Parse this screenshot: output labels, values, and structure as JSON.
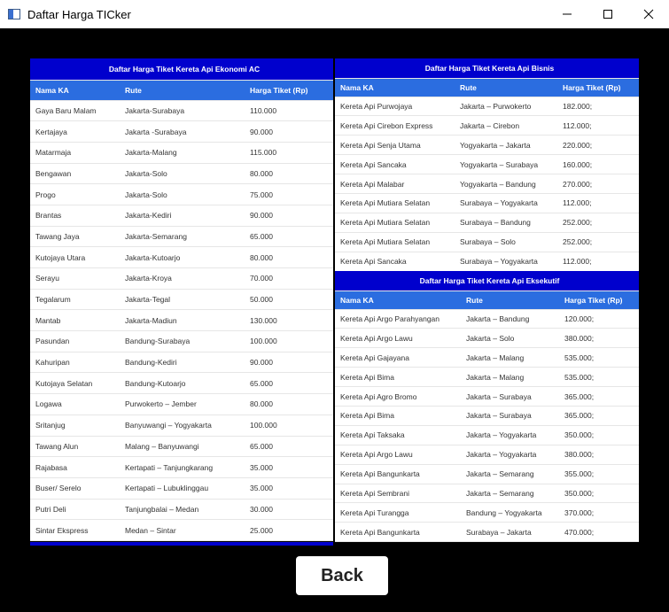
{
  "window": {
    "title": "Daftar Harga TICker"
  },
  "ekonomi": {
    "title": "Daftar Harga Tiket Kereta Api Ekonomi AC",
    "headers": [
      "Nama KA",
      "Rute",
      "Harga Tiket (Rp)"
    ],
    "rows": [
      [
        "Gaya Baru Malam",
        "Jakarta-Surabaya",
        "110.000"
      ],
      [
        "Kertajaya",
        "Jakarta -Surabaya",
        "90.000"
      ],
      [
        "Matarmaja",
        "Jakarta-Malang",
        "115.000"
      ],
      [
        "Bengawan",
        "Jakarta-Solo",
        "80.000"
      ],
      [
        "Progo",
        "Jakarta-Solo",
        "75.000"
      ],
      [
        "Brantas",
        "Jakarta-Kediri",
        "90.000"
      ],
      [
        "Tawang Jaya",
        "Jakarta-Semarang",
        "65.000"
      ],
      [
        "Kutojaya Utara",
        "Jakarta-Kutoarjo",
        "80.000"
      ],
      [
        "Serayu",
        "Jakarta-Kroya",
        "70.000"
      ],
      [
        "Tegalarum",
        "Jakarta-Tegal",
        "50.000"
      ],
      [
        "Mantab",
        "Jakarta-Madiun",
        "130.000"
      ],
      [
        "Pasundan",
        "Bandung-Surabaya",
        "100.000"
      ],
      [
        "Kahuripan",
        "Bandung-Kediri",
        "90.000"
      ],
      [
        "Kutojaya Selatan",
        "Bandung-Kutoarjo",
        "65.000"
      ],
      [
        "Logawa",
        "Purwokerto – Jember",
        "80.000"
      ],
      [
        "Sritanjug",
        "Banyuwangi – Yogyakarta",
        "100.000"
      ],
      [
        "Tawang Alun",
        "Malang – Banyuwangi",
        "65.000"
      ],
      [
        "Rajabasa",
        "Kertapati – Tanjungkarang",
        "35.000"
      ],
      [
        "Buser/ Serelo",
        "Kertapati – Lubuklinggau",
        "35.000"
      ],
      [
        "Putri Deli",
        "Tanjungbalai – Medan",
        "30.000"
      ],
      [
        "Sintar Ekspress",
        "Medan – Sintar",
        "25.000"
      ]
    ]
  },
  "bisnis": {
    "title": "Daftar Harga Tiket Kereta Api Bisnis",
    "headers": [
      "Nama KA",
      "Rute",
      "Harga Tiket (Rp)"
    ],
    "rows": [
      [
        "Kereta Api Purwojaya",
        "Jakarta – Purwokerto",
        "182.000;"
      ],
      [
        "Kereta Api Cirebon Express",
        "Jakarta – Cirebon",
        "112.000;"
      ],
      [
        "Kereta Api Senja Utama",
        "Yogyakarta – Jakarta",
        "220.000;"
      ],
      [
        "Kereta Api Sancaka",
        "Yogyakarta – Surabaya",
        "160.000;"
      ],
      [
        "Kereta Api Malabar",
        "Yogyakarta – Bandung",
        "270.000;"
      ],
      [
        "Kereta Api Mutiara Selatan",
        "Surabaya – Yogyakarta",
        "112.000;"
      ],
      [
        "Kereta Api Mutiara Selatan",
        "Surabaya – Bandung",
        "252.000;"
      ],
      [
        "Kereta Api Mutiara Selatan",
        "Surabaya – Solo",
        "252.000;"
      ],
      [
        "Kereta Api Sancaka",
        "Surabaya – Yogyakarta",
        "112.000;"
      ]
    ]
  },
  "eksekutif": {
    "title": "Daftar Harga Tiket Kereta Api Eksekutif",
    "headers": [
      "Nama KA",
      "Rute",
      "Harga Tiket (Rp)"
    ],
    "rows": [
      [
        "Kereta Api Argo Parahyangan",
        "Jakarta – Bandung",
        "120.000;"
      ],
      [
        "Kereta Api Argo Lawu",
        "Jakarta – Solo",
        "380.000;"
      ],
      [
        "Kereta Api Gajayana",
        "Jakarta – Malang",
        "535.000;"
      ],
      [
        "Kereta Api Bima",
        "Jakarta – Malang",
        "535.000;"
      ],
      [
        "Kereta Api Agro Bromo",
        "Jakarta – Surabaya",
        "365.000;"
      ],
      [
        "Kereta Api Bima",
        "Jakarta – Surabaya",
        "365.000;"
      ],
      [
        "Kereta Api Taksaka",
        "Jakarta – Yogyakarta",
        "350.000;"
      ],
      [
        "Kereta Api Argo Lawu",
        "Jakarta – Yogyakarta",
        "380.000;"
      ],
      [
        "Kereta Api Bangunkarta",
        "Jakarta – Semarang",
        "355.000;"
      ],
      [
        "Kereta Api Sembrani",
        "Jakarta – Semarang",
        "350.000;"
      ],
      [
        "Kereta Api Turangga",
        "Bandung – Yogyakarta",
        "370.000;"
      ],
      [
        "Kereta Api Bangunkarta",
        "Surabaya – Jakarta",
        "470.000;"
      ]
    ]
  },
  "back_label": "Back"
}
